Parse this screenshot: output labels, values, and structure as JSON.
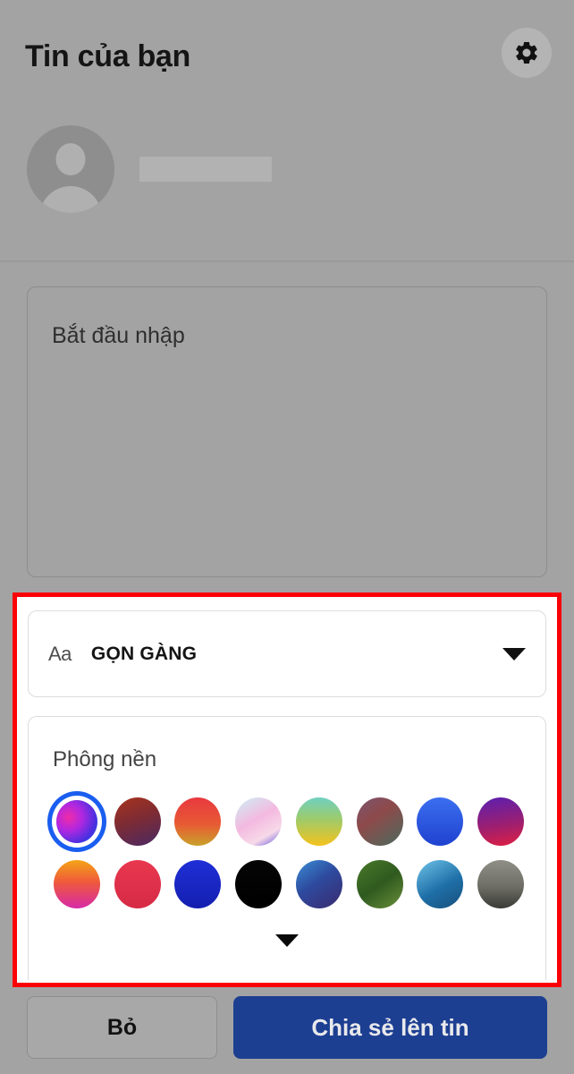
{
  "header": {
    "title": "Tin của bạn",
    "settings_icon": "gear-icon",
    "avatar_icon": "person-avatar-icon",
    "user_name": ""
  },
  "composer": {
    "placeholder": "Bắt đầu nhập",
    "value": ""
  },
  "font_selector": {
    "aa_glyph": "Aa",
    "selected_font": "GỌN GÀNG",
    "caret_icon": "chevron-down-icon"
  },
  "background_panel": {
    "label": "Phông nền",
    "expand_icon": "chevron-down-icon",
    "swatches": [
      {
        "name": "swatch-1",
        "selected": true,
        "css": "radial-gradient(circle at 30% 40%, #f02ba8 0%, #b028e0 35%, #4a2fe0 70%, #1a5ef0 100%)"
      },
      {
        "name": "swatch-2",
        "selected": false,
        "css": "linear-gradient(160deg, #a8331d 0%, #7e2b33 45%, #4a2a63 100%)"
      },
      {
        "name": "swatch-3",
        "selected": false,
        "css": "linear-gradient(180deg, #e8383f 0%, #e85a34 55%, #c9a12a 100%)"
      },
      {
        "name": "swatch-4",
        "selected": false,
        "css": "linear-gradient(150deg, #cdf0f5 0%, #f3b9e0 45%, #f7d9e8 75%, #5a4fe0 100%)"
      },
      {
        "name": "swatch-5",
        "selected": false,
        "css": "linear-gradient(180deg, #6fd0c0 0%, #9ecb6a 45%, #f5c21d 100%)"
      },
      {
        "name": "swatch-6",
        "selected": false,
        "css": "linear-gradient(145deg, #7a5570 0%, #8e4a4a 40%, #4a6b5e 100%)"
      },
      {
        "name": "swatch-7",
        "selected": false,
        "css": "linear-gradient(180deg, #3b6ef0 0%, #1f42cf 100%)"
      },
      {
        "name": "swatch-8",
        "selected": false,
        "css": "linear-gradient(170deg, #5a1fb0 0%, #9b1f72 55%, #e01f40 100%)"
      },
      {
        "name": "swatch-9",
        "selected": false,
        "css": "linear-gradient(180deg, #f5a417 0%, #ef5a3a 45%, #d62aa8 100%)"
      },
      {
        "name": "swatch-10",
        "selected": false,
        "css": "linear-gradient(180deg, #e8384f 0%, #d62a45 100%)"
      },
      {
        "name": "swatch-11",
        "selected": false,
        "css": "linear-gradient(180deg, #1f2fd6 0%, #141fb0 100%)"
      },
      {
        "name": "swatch-12",
        "selected": false,
        "css": "linear-gradient(180deg, #050505 0%, #000000 100%)"
      },
      {
        "name": "swatch-13",
        "selected": false,
        "css": "linear-gradient(145deg, #3a8fd6 0%, #2e4a9e 45%, #3a2a6e 100%)"
      },
      {
        "name": "swatch-14",
        "selected": false,
        "css": "linear-gradient(145deg, #4a7a2a 0%, #2f5a1f 50%, #6a8f3a 100%)"
      },
      {
        "name": "swatch-15",
        "selected": false,
        "css": "linear-gradient(150deg, #6fc4e8 0%, #1f6fa8 55%, #174f7a 100%)"
      },
      {
        "name": "swatch-16",
        "selected": false,
        "css": "linear-gradient(180deg, #8f8f87 0%, #6e6e66 55%, #3a3a36 100%)"
      }
    ]
  },
  "actions": {
    "discard_label": "Bỏ",
    "share_label": "Chia sẻ lên tin"
  },
  "annotation": {
    "color": "#fb0007"
  }
}
